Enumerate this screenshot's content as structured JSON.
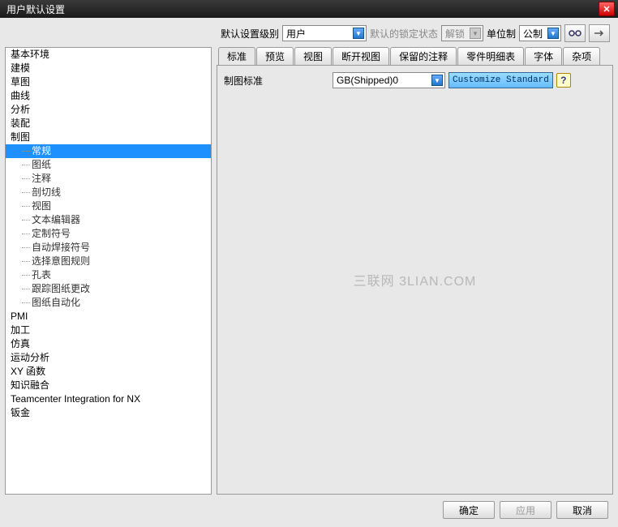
{
  "window": {
    "title": "用户默认设置"
  },
  "toolbar": {
    "level_label": "默认设置级别",
    "level_value": "用户",
    "lock_label": "默认的锁定状态",
    "lock_value": "解锁",
    "units_label": "单位制",
    "units_value": "公制"
  },
  "tree": {
    "items": [
      {
        "label": "基本环境",
        "depth": 0
      },
      {
        "label": "建模",
        "depth": 0
      },
      {
        "label": "草图",
        "depth": 0
      },
      {
        "label": "曲线",
        "depth": 0
      },
      {
        "label": "分析",
        "depth": 0
      },
      {
        "label": "装配",
        "depth": 0
      },
      {
        "label": "制图",
        "depth": 0
      },
      {
        "label": "常规",
        "depth": 1,
        "selected": true
      },
      {
        "label": "图纸",
        "depth": 1
      },
      {
        "label": "注释",
        "depth": 1
      },
      {
        "label": "剖切线",
        "depth": 1
      },
      {
        "label": "视图",
        "depth": 1
      },
      {
        "label": "文本编辑器",
        "depth": 1
      },
      {
        "label": "定制符号",
        "depth": 1
      },
      {
        "label": "自动焊接符号",
        "depth": 1
      },
      {
        "label": "选择意图规则",
        "depth": 1
      },
      {
        "label": "孔表",
        "depth": 1
      },
      {
        "label": "跟踪图纸更改",
        "depth": 1
      },
      {
        "label": "图纸自动化",
        "depth": 1
      },
      {
        "label": "PMI",
        "depth": 0
      },
      {
        "label": "加工",
        "depth": 0
      },
      {
        "label": "仿真",
        "depth": 0
      },
      {
        "label": "运动分析",
        "depth": 0
      },
      {
        "label": "XY 函数",
        "depth": 0
      },
      {
        "label": "知识融合",
        "depth": 0
      },
      {
        "label": "Teamcenter Integration for NX",
        "depth": 0
      },
      {
        "label": "钣金",
        "depth": 0
      }
    ]
  },
  "tabs": [
    {
      "label": "标准",
      "active": true
    },
    {
      "label": "预览"
    },
    {
      "label": "视图"
    },
    {
      "label": "断开视图"
    },
    {
      "label": "保留的注释"
    },
    {
      "label": "零件明细表"
    },
    {
      "label": "字体"
    },
    {
      "label": "杂项"
    }
  ],
  "panel": {
    "std_label": "制图标准",
    "std_value": "GB(Shipped)0",
    "customize_btn": "Customize Standard"
  },
  "footer": {
    "ok": "确定",
    "apply": "应用",
    "cancel": "取消"
  },
  "watermark": "三联网 3LIAN.COM"
}
